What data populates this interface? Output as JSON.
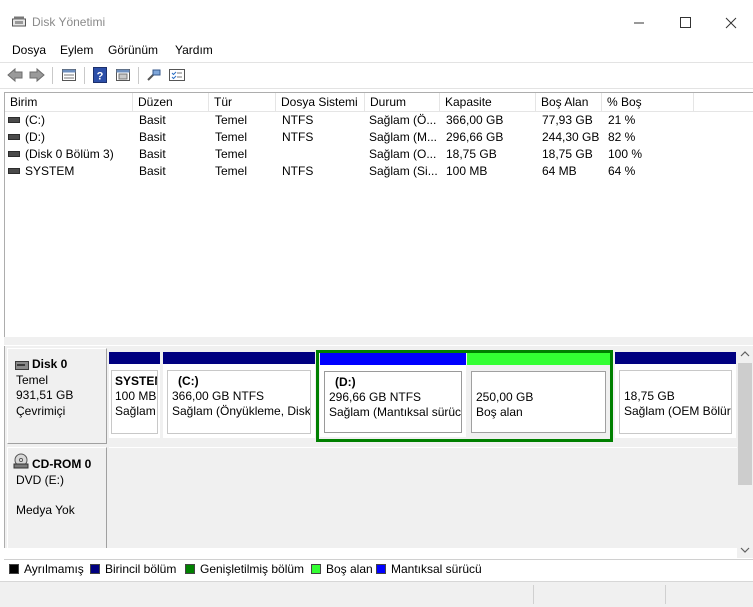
{
  "window": {
    "title": "Disk Yönetimi"
  },
  "menu": [
    "Dosya",
    "Eylem",
    "Görünüm",
    "Yardım"
  ],
  "toolbar": {
    "icons": [
      "back-arrow-icon",
      "forward-arrow-icon",
      "disk-list-icon",
      "help-icon",
      "properties-icon",
      "connect-icon",
      "checklist-icon"
    ]
  },
  "volumes": {
    "columns": [
      "Birim",
      "Düzen",
      "Tür",
      "Dosya Sistemi",
      "Durum",
      "Kapasite",
      "Boş Alan",
      "% Boş"
    ],
    "rows": [
      [
        "(C:)",
        "Basit",
        "Temel",
        "NTFS",
        "Sağlam (Ö...",
        "366,00 GB",
        "77,93 GB",
        "21 %"
      ],
      [
        "(D:)",
        "Basit",
        "Temel",
        "NTFS",
        "Sağlam (M...",
        "296,66 GB",
        "244,30 GB",
        "82 %"
      ],
      [
        "(Disk 0 Bölüm 3)",
        "Basit",
        "Temel",
        "",
        "Sağlam (O...",
        "18,75 GB",
        "18,75 GB",
        "100 %"
      ],
      [
        "SYSTEM",
        "Basit",
        "Temel",
        "NTFS",
        "Sağlam (Si...",
        "100 MB",
        "64 MB",
        "64 %"
      ]
    ]
  },
  "disks": [
    {
      "name": "Disk 0",
      "type": "Temel",
      "size": "931,51 GB",
      "status": "Çevrimiçi",
      "partitions": [
        {
          "title": "SYSTEM",
          "line1": "100 MB",
          "line2": "Sağlam",
          "kind": "primary"
        },
        {
          "title": "(C:)",
          "line1": "366,00 GB NTFS",
          "line2": "Sağlam (Önyükleme, Disk",
          "kind": "primary"
        },
        {
          "title": "(D:)",
          "line1": "296,66 GB NTFS",
          "line2": "Sağlam (Mantıksal sürüc",
          "kind": "logical",
          "selected": true
        },
        {
          "title": "",
          "line1": "250,00 GB",
          "line2": "Boş alan",
          "kind": "free"
        },
        {
          "title": "",
          "line1": "18,75 GB",
          "line2": "Sağlam (OEM Bölür",
          "kind": "primary"
        }
      ]
    },
    {
      "name": "CD-ROM 0",
      "type": "DVD (E:)",
      "size": "",
      "status": "Medya Yok"
    }
  ],
  "legend": [
    {
      "label": "Ayrılmamış",
      "color": "#000000"
    },
    {
      "label": "Birincil bölüm",
      "color": "#000080"
    },
    {
      "label": "Genişletilmiş bölüm",
      "color": "#008000"
    },
    {
      "label": "Boş alan",
      "color": "#33ff33"
    },
    {
      "label": "Mantıksal sürücü",
      "color": "#0000ff"
    }
  ],
  "colors": {
    "primary": "#000080",
    "logical": "#0000ff",
    "extended": "#008000",
    "free": "#33ff33"
  }
}
